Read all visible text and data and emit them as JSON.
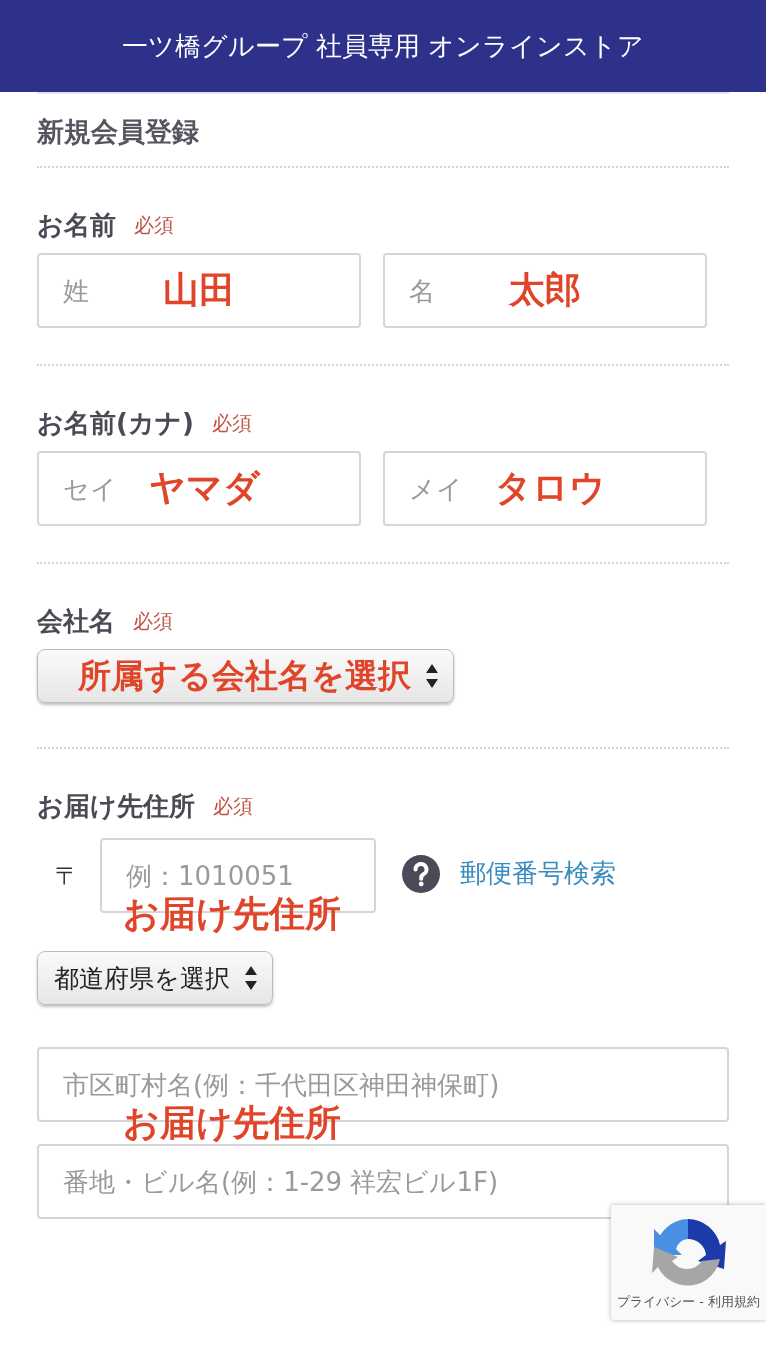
{
  "header": {
    "title": "一ツ橋グループ 社員専用 オンラインストア"
  },
  "page_title": "新規会員登録",
  "sections": [
    {
      "kind": "pair",
      "label": "お名前",
      "required": "必須",
      "fields": [
        {
          "placeholder": "姓",
          "annotation": "山田"
        },
        {
          "placeholder": "名",
          "annotation": "太郎"
        }
      ]
    },
    {
      "kind": "pair",
      "label": "お名前(カナ)",
      "required": "必須",
      "fields": [
        {
          "placeholder": "セイ",
          "annotation": "ヤマダ"
        },
        {
          "placeholder": "メイ",
          "annotation": "タロウ"
        }
      ]
    },
    {
      "kind": "select",
      "label": "会社名",
      "required": "必須",
      "select": {
        "value": "所属する会社名を選択",
        "highlighted": true
      }
    },
    {
      "kind": "address",
      "label": "お届け先住所",
      "required": "必須",
      "postal": {
        "mark": "〒",
        "placeholder": "例：1010051",
        "annotation": "お届け先住所"
      },
      "help_link": "郵便番号検索",
      "prefecture": {
        "value": "都道府県を選択",
        "highlighted": false
      },
      "city": {
        "placeholder": "市区町村名(例：千代田区神田神保町)",
        "annotation": "お届け先住所"
      },
      "street": {
        "placeholder": "番地・ビル名(例：1-29 祥宏ビル1F)"
      }
    }
  ],
  "recaptcha": {
    "links": "プライバシー - 利用規約"
  }
}
